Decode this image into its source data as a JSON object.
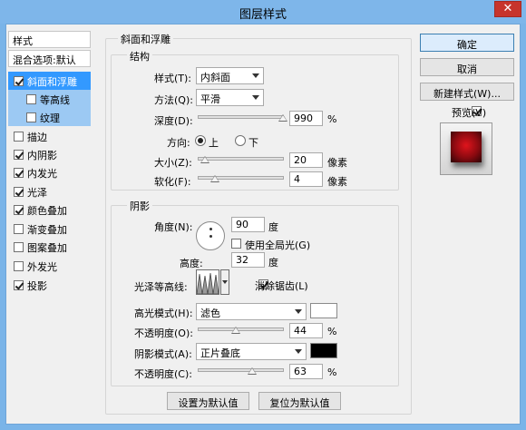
{
  "window": {
    "title": "图层样式",
    "close_glyph": "✕"
  },
  "style_list": {
    "header": "样式",
    "blend_label": "混合选项:默认",
    "items": [
      {
        "label": "斜面和浮雕",
        "checked": true
      },
      {
        "label": "等高线",
        "checked": false
      },
      {
        "label": "纹理",
        "checked": false
      },
      {
        "label": "描边",
        "checked": false
      },
      {
        "label": "内阴影",
        "checked": true
      },
      {
        "label": "内发光",
        "checked": true
      },
      {
        "label": "光泽",
        "checked": true
      },
      {
        "label": "颜色叠加",
        "checked": true
      },
      {
        "label": "渐变叠加",
        "checked": false
      },
      {
        "label": "图案叠加",
        "checked": false
      },
      {
        "label": "外发光",
        "checked": false
      },
      {
        "label": "投影",
        "checked": true
      }
    ]
  },
  "bevel": {
    "legend": "斜面和浮雕",
    "structure": {
      "legend": "结构",
      "style_label": "样式(T):",
      "style_value": "内斜面",
      "technique_label": "方法(Q):",
      "technique_value": "平滑",
      "depth_label": "深度(D):",
      "depth_value": "990",
      "depth_unit": "%",
      "direction_label": "方向:",
      "direction_up": "上",
      "direction_down": "下",
      "size_label": "大小(Z):",
      "size_value": "20",
      "size_unit": "像素",
      "soften_label": "软化(F):",
      "soften_value": "4",
      "soften_unit": "像素"
    },
    "shading": {
      "legend": "阴影",
      "angle_label": "角度(N):",
      "angle_value": "90",
      "angle_unit": "度",
      "global_light_label": "使用全局光(G)",
      "altitude_label": "高度:",
      "altitude_value": "32",
      "altitude_unit": "度",
      "gloss_contour_label": "光泽等高线:",
      "anti_alias_label": "消除锯齿(L)",
      "highlight_mode_label": "高光模式(H):",
      "highlight_mode_value": "滤色",
      "highlight_color": "#ffffff",
      "highlight_opacity_label": "不透明度(O):",
      "highlight_opacity_value": "44",
      "highlight_opacity_unit": "%",
      "shadow_mode_label": "阴影模式(A):",
      "shadow_mode_value": "正片叠底",
      "shadow_color": "#000000",
      "shadow_opacity_label": "不透明度(C):",
      "shadow_opacity_value": "63",
      "shadow_opacity_unit": "%"
    },
    "make_default": "设置为默认值",
    "reset_default": "复位为默认值"
  },
  "actions": {
    "ok": "确定",
    "cancel": "取消",
    "new_style": "新建样式(W)...",
    "preview_label": "预览(V)"
  },
  "sliders": {
    "depth_fraction": 0.99,
    "size_fraction": 0.08,
    "soften_fraction": 0.2,
    "highlight_opacity_fraction": 0.44,
    "shadow_opacity_fraction": 0.63
  },
  "colors": {
    "accent": "#3399ff",
    "titlebar": "#7eb6ea",
    "close": "#c7342c"
  }
}
